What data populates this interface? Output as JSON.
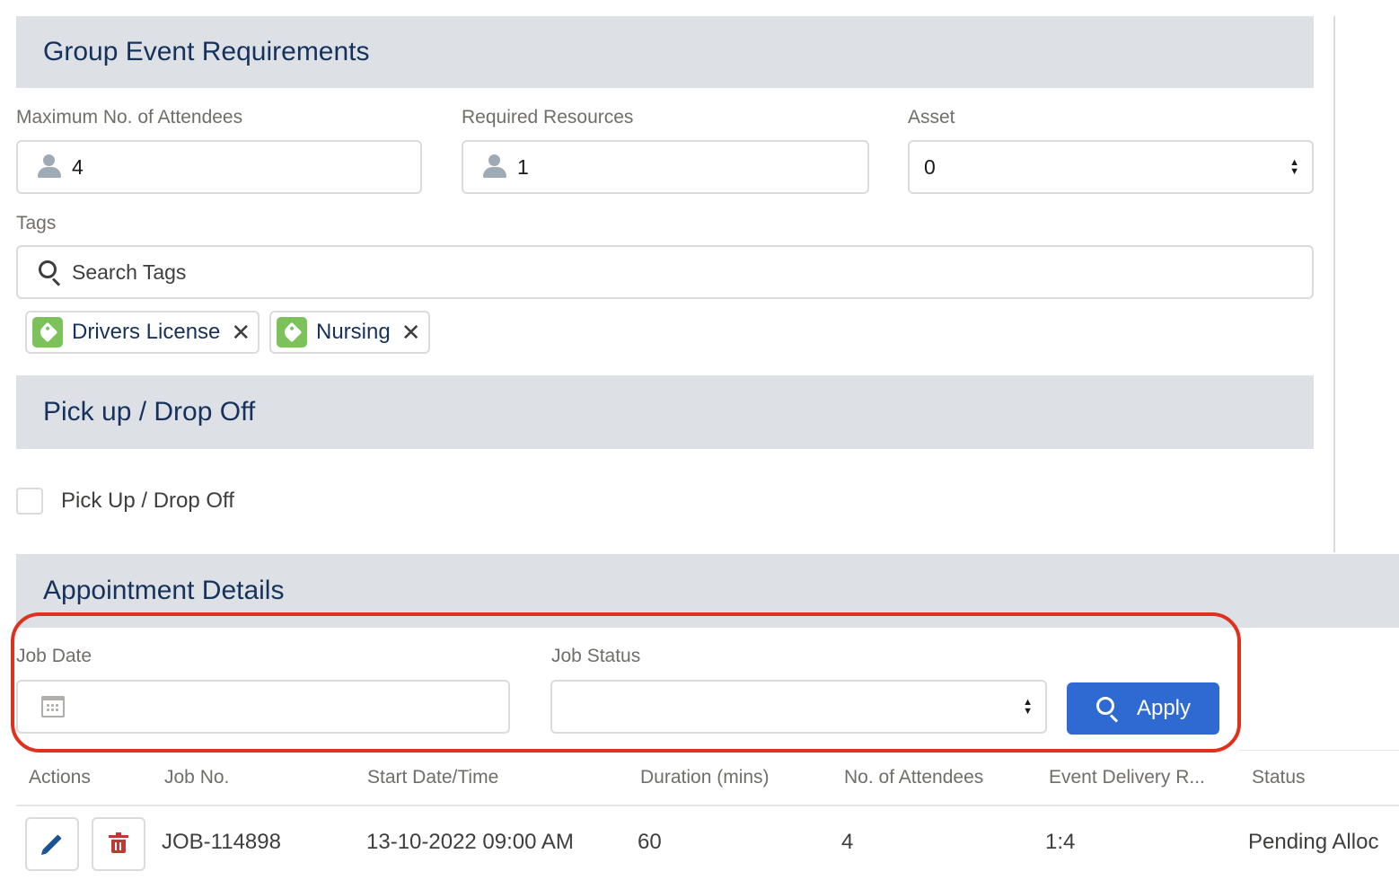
{
  "sections": {
    "group_event": "Group Event Requirements",
    "pickup": "Pick up / Drop Off",
    "appointment": "Appointment Details"
  },
  "fields": {
    "max_attendees": {
      "label": "Maximum No. of Attendees",
      "value": "4",
      "icon": "person-icon"
    },
    "required_resources": {
      "label": "Required Resources",
      "value": "1",
      "icon": "person-icon"
    },
    "asset": {
      "label": "Asset",
      "value": "0"
    },
    "tags": {
      "label": "Tags",
      "placeholder": "Search Tags"
    }
  },
  "tags": [
    {
      "label": "Drivers License",
      "icon": "tag-icon",
      "color": "#7bc25a"
    },
    {
      "label": "Nursing",
      "icon": "tag-icon",
      "color": "#7bc25a"
    }
  ],
  "pickup_checkbox": {
    "label": "Pick Up / Drop Off",
    "checked": false
  },
  "filters": {
    "job_date": {
      "label": "Job Date",
      "value": ""
    },
    "job_status": {
      "label": "Job Status",
      "value": ""
    },
    "apply_label": "Apply"
  },
  "table": {
    "columns": [
      "Actions",
      "Job No.",
      "Start Date/Time",
      "Duration (mins)",
      "No. of Attendees",
      "Event Delivery R...",
      "Status"
    ],
    "rows": [
      {
        "job_no": "JOB-114898",
        "start": "13-10-2022 09:00 AM",
        "duration": "60",
        "attendees": "4",
        "delivery_ratio": "1:4",
        "status": "Pending Alloc"
      }
    ]
  },
  "colors": {
    "header_bg": "#dde1e6",
    "brand_blue": "#2f6ad3",
    "highlight_red": "#e0301e",
    "tag_green": "#7bc25a",
    "delete_red": "#c23934"
  }
}
